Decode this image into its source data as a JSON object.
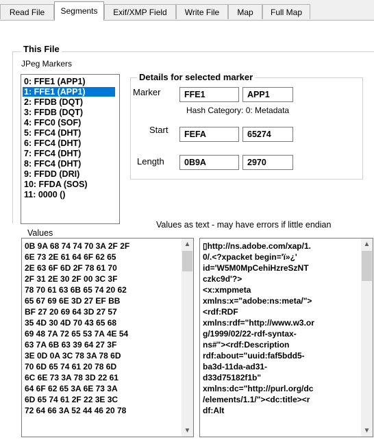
{
  "tabs": [
    "Read File",
    "Segments",
    "Exif/XMP Field",
    "Write File",
    "Map",
    "Full Map"
  ],
  "section_title": "This File",
  "markers_label": "JPeg Markers",
  "markers": [
    "0: FFE1  (APP1)",
    "1: FFE1  (APP1)",
    "2: FFDB  (DQT)",
    "3: FFDB  (DQT)",
    "4: FFC0  (SOF)",
    "5: FFC4  (DHT)",
    "6: FFC4  (DHT)",
    "7: FFC4  (DHT)",
    "8: FFC4  (DHT)",
    "9: FFDD  (DRI)",
    "10: FFDA  (SOS)",
    "11: 0000  ()"
  ],
  "selected_marker_index": 1,
  "details": {
    "title": "Details for selected marker",
    "marker_label": "Marker",
    "marker_code": "FFE1",
    "marker_name": "APP1",
    "hash_category": "Hash Category: 0: Metadata",
    "start_label": "Start",
    "start_hex": "FEFA",
    "start_dec": "65274",
    "length_label": "Length",
    "length_hex": "0B9A",
    "length_dec": "2970"
  },
  "values_label": "Values",
  "text_note": "Values as text - may have errors if little endian",
  "hex_lines": [
    "0B 9A 68 74 74 70 3A 2F 2F",
    "6E 73 2E 61 64 6F 62 65",
    "2E 63 6F 6D 2F 78 61 70",
    "2F 31 2E 30 2F 00 3C 3F",
    "78 70 61 63 6B 65 74 20 62",
    "65 67 69 6E 3D 27 EF BB",
    "BF 27 20 69 64 3D 27 57",
    "35 4D 30 4D 70 43 65 68",
    "69 48 7A 72 65 53 7A 4E 54",
    "63 7A 6B 63 39 64 27 3F",
    "3E 0D 0A 3C 78 3A 78 6D",
    "70 6D 65 74 61 20 78 6D",
    "6C 6E 73 3A 78 3D 22 61",
    "64 6F 62 65 3A 6E 73 3A",
    "6D 65 74 61 2F 22 3E 3C",
    "72 64 66 3A 52 44 46 20 78"
  ],
  "text_lines": [
    "▯http://ns.adobe.com/xap/1.",
    "0/.<?xpacket begin='ï»¿'",
    "id='W5M0MpCehiHzreSzNT",
    "czkc9d'?>",
    "<x:xmpmeta",
    "xmlns:x=\"adobe:ns:meta/\">",
    "<rdf:RDF",
    "xmlns:rdf=\"http://www.w3.or",
    "g/1999/02/22-rdf-syntax-",
    "ns#\"><rdf:Description",
    "rdf:about=\"uuid:faf5bdd5-",
    "ba3d-11da-ad31-",
    "d33d75182f1b\"",
    "xmlns:dc=\"http://purl.org/dc",
    "/elements/1.1/\"><dc:title><r",
    "df:Alt"
  ],
  "icons": {
    "scroll_up": "scroll-up-arrow-icon",
    "scroll_down": "scroll-down-arrow-icon"
  },
  "colors": {
    "selection": "#0078d7",
    "tab_bar": "#f0f0f0"
  }
}
